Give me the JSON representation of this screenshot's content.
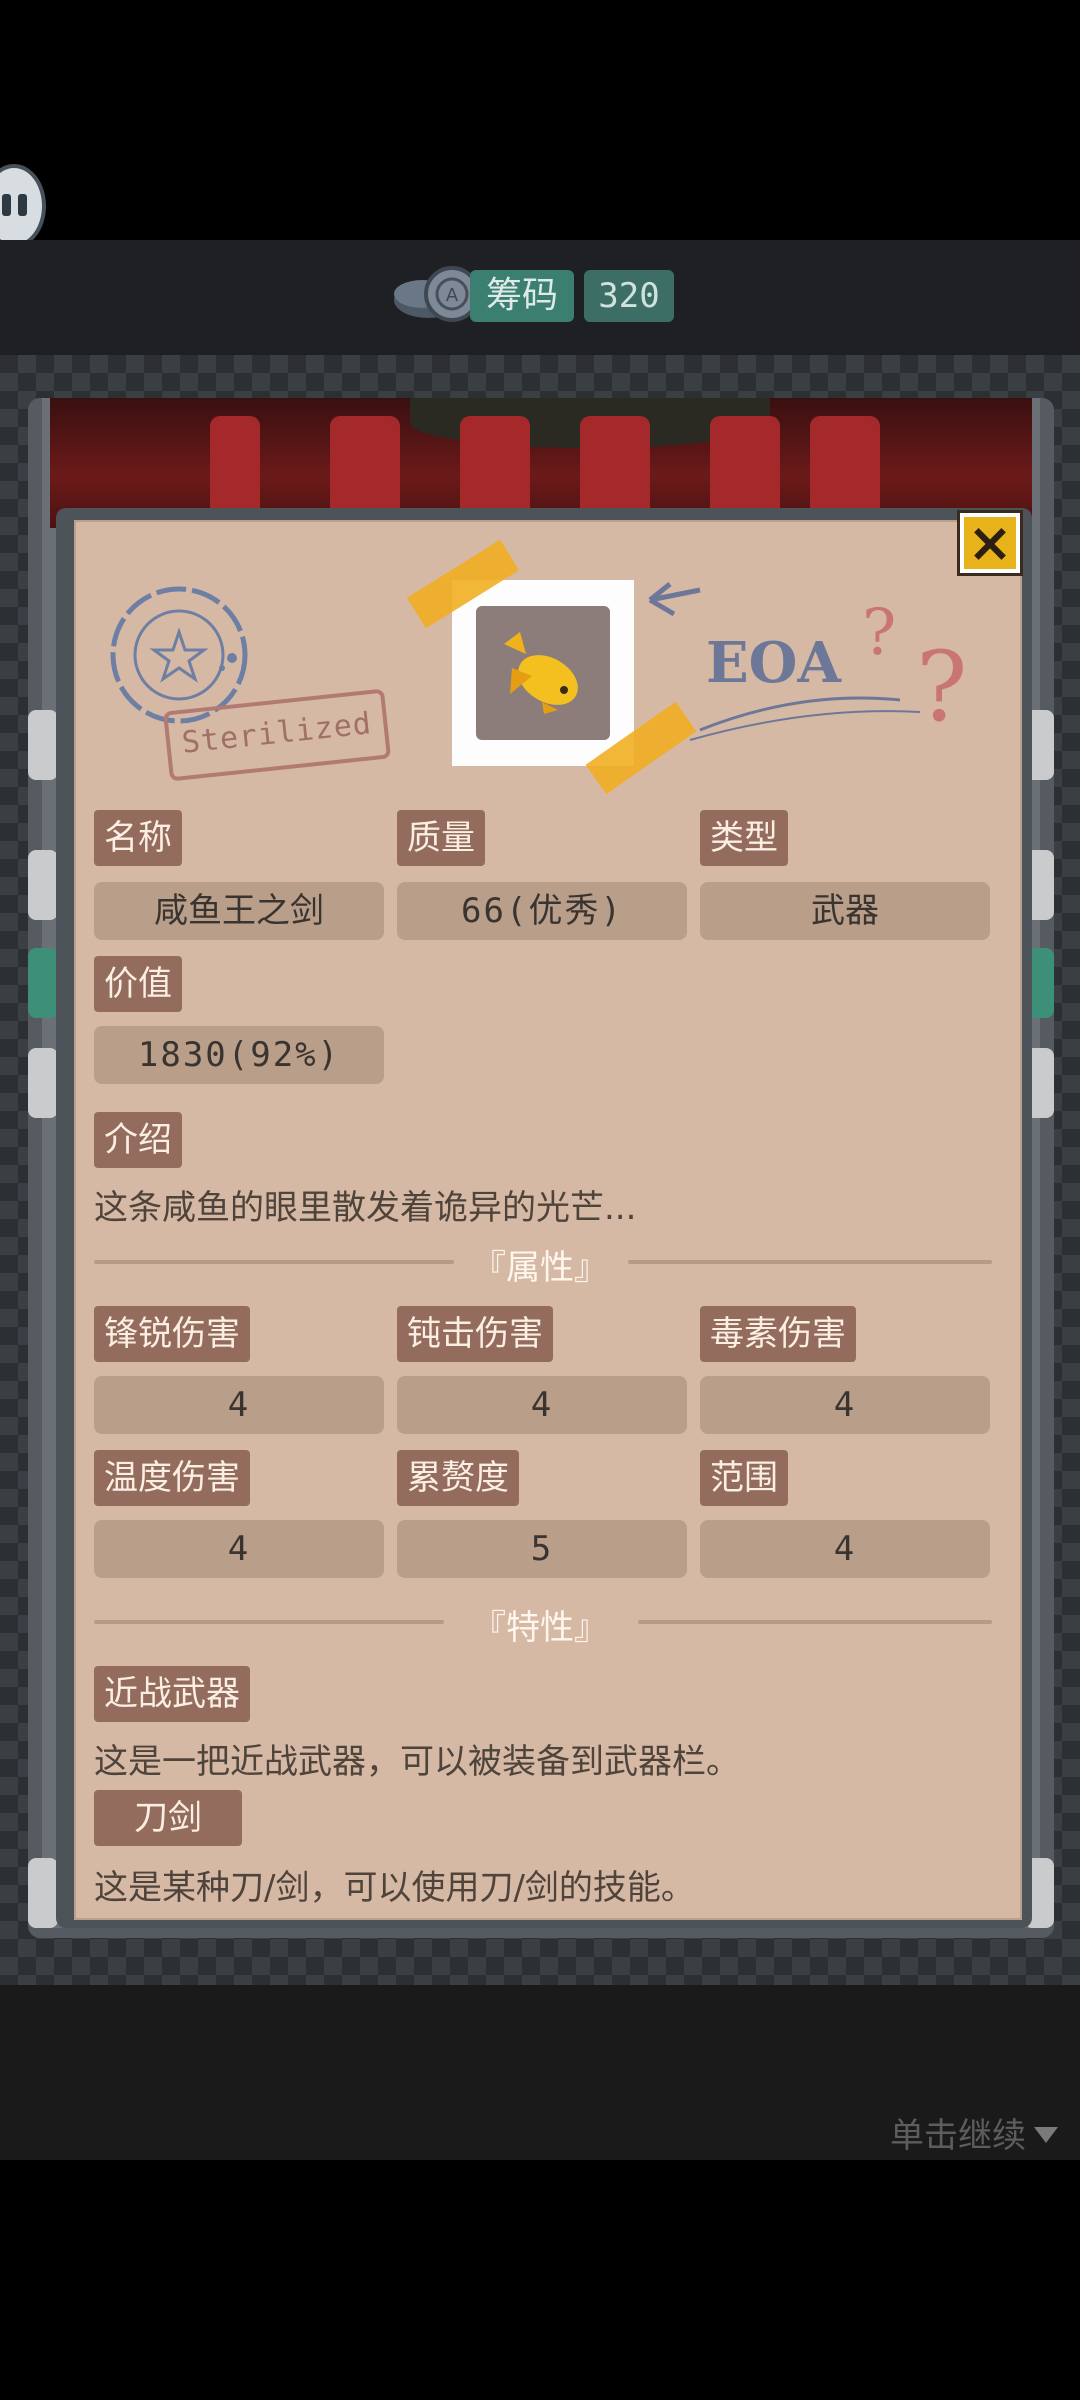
{
  "topbar": {
    "chip_label": "筹码",
    "chip_count": "320"
  },
  "item": {
    "stamp_text": "Sterilized",
    "name_label": "名称",
    "name_value": "咸鱼王之剑",
    "quality_label": "质量",
    "quality_value": "66(优秀)",
    "type_label": "类型",
    "type_value": "武器",
    "price_label": "价值",
    "price_value": "1830(92%)",
    "intro_label": "介绍",
    "intro_text": "这条咸鱼的眼里散发着诡异的光芒..."
  },
  "attributes": {
    "title": "『属性』",
    "sharp_label": "锋锐伤害",
    "sharp_value": "4",
    "blunt_label": "钝击伤害",
    "blunt_value": "4",
    "poison_label": "毒素伤害",
    "poison_value": "4",
    "temp_label": "温度伤害",
    "temp_value": "4",
    "weight_label": "累赘度",
    "weight_value": "5",
    "range_label": "范围",
    "range_value": "4"
  },
  "traits": {
    "title": "『特性』",
    "melee_label": "近战武器",
    "melee_desc": "这是一把近战武器，可以被装备到武器栏。",
    "blade_label": "刀剑",
    "blade_desc": "这是某种刀/剑，可以使用刀/剑的技能。"
  },
  "footer": {
    "continue_text": "单击继续"
  },
  "icons": [
    "chat-icon",
    "chip-icon",
    "close-icon",
    "fish-icon",
    "arrow-icon",
    "triangle-down-icon"
  ],
  "colors": {
    "card_bg": "#d6b9a4",
    "label_bg": "#936c5d",
    "value_bg": "#b99e89",
    "accent_green": "#3b7f71",
    "close_yellow": "#e8b21a"
  }
}
